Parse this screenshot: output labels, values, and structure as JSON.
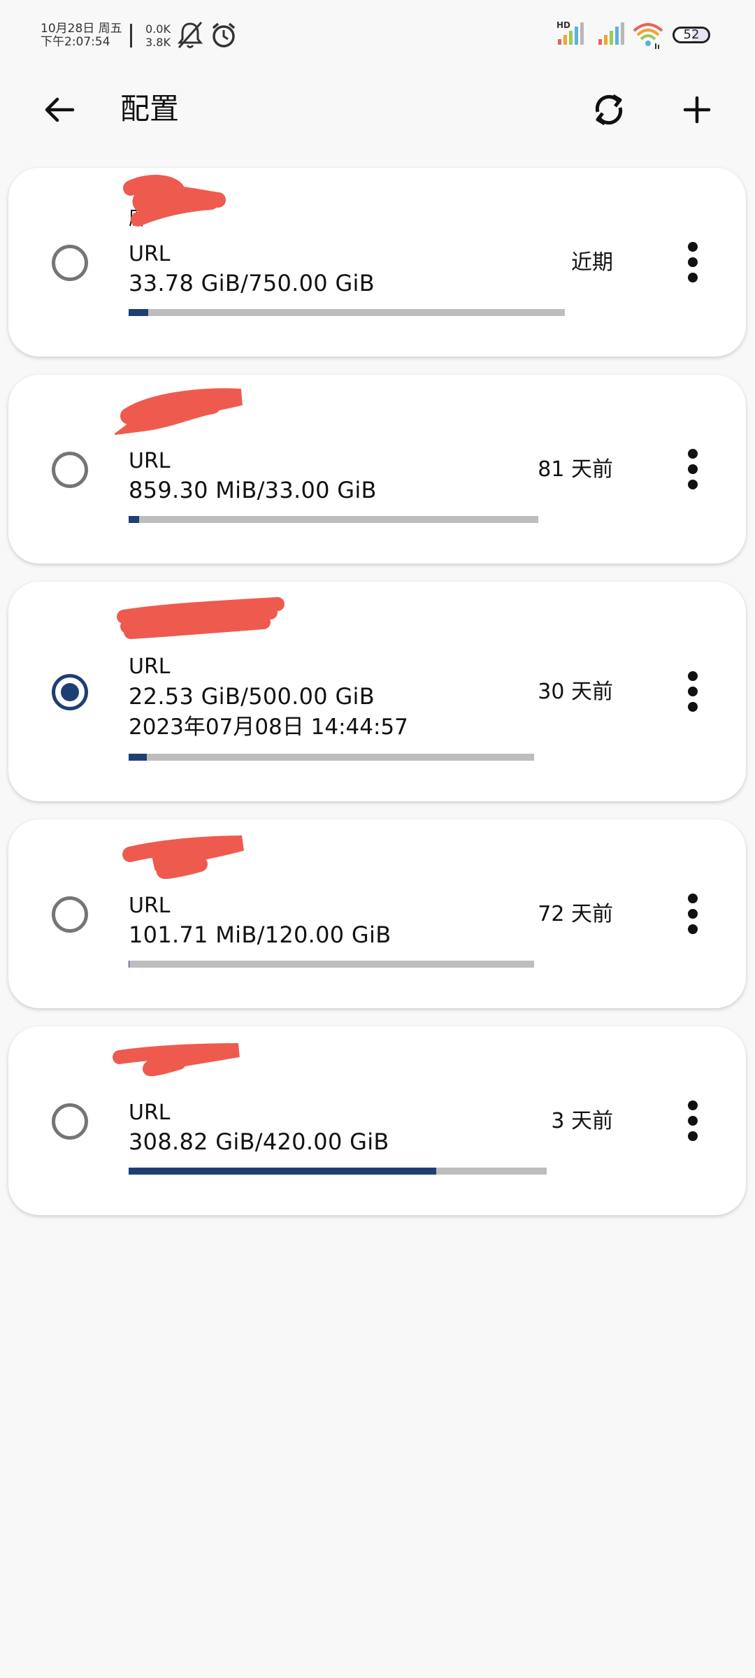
{
  "status_bar": {
    "date": "10月28日 周五",
    "time": "下午2:07:54",
    "speed_up": "0.0K",
    "speed_down": "3.8K",
    "battery": "52",
    "icons": [
      "bell-off-icon",
      "alarm-icon",
      "hd-signal-icon",
      "signal-icon",
      "wifi-icon",
      "battery-icon"
    ]
  },
  "appbar": {
    "title": "配置",
    "icons": [
      "back-arrow-icon",
      "refresh-icon",
      "add-icon"
    ]
  },
  "accent_color": "#1e3f73",
  "profiles": [
    {
      "name": "廊",
      "type": "URL",
      "usage": "33.78 GiB/750.00 GiB",
      "expire": "",
      "updated": "近期",
      "progress": 0.045,
      "selected": false
    },
    {
      "name": "",
      "type": "URL",
      "usage": "859.30 MiB/33.00 GiB",
      "expire": "",
      "updated": "81 天前",
      "progress": 0.026,
      "selected": false
    },
    {
      "name": "",
      "type": "URL",
      "usage": "22.53 GiB/500.00 GiB",
      "expire": "2023年07月08日 14:44:57",
      "updated": "30 天前",
      "progress": 0.045,
      "selected": true
    },
    {
      "name": "",
      "type": "URL",
      "usage": "101.71 MiB/120.00 GiB",
      "expire": "",
      "updated": "72 天前",
      "progress": 0.001,
      "selected": false
    },
    {
      "name": "",
      "type": "URL",
      "usage": "308.82 GiB/420.00 GiB",
      "expire": "",
      "updated": "3 天前",
      "progress": 0.735,
      "selected": false
    }
  ]
}
